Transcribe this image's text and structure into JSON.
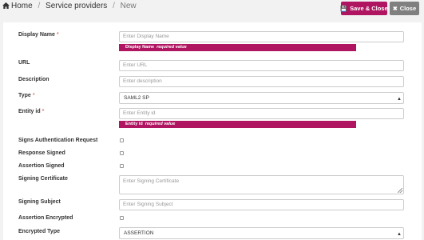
{
  "breadcrumb": {
    "home": "Home",
    "section": "Service providers",
    "current": "New"
  },
  "toolbar": {
    "save_label": "Save & Close",
    "close_label": "Close"
  },
  "form": {
    "display_name": {
      "label": "Display Name",
      "required": "*",
      "placeholder": "Enter Display Name",
      "error_field": "Display Name",
      "error_text": "required value"
    },
    "url": {
      "label": "URL",
      "placeholder": "Enter URL"
    },
    "description": {
      "label": "Description",
      "placeholder": "Enter description"
    },
    "type": {
      "label": "Type",
      "required": "*",
      "value": "SAML2 SP"
    },
    "entity_id": {
      "label": "Entity id",
      "required": "*",
      "placeholder": "Enter Entity id",
      "error_field": "Entity id",
      "error_text": "required value"
    },
    "signs_auth_request": {
      "label": "Signs Authentication Request",
      "checked": false
    },
    "response_signed": {
      "label": "Response Signed",
      "checked": false
    },
    "assertion_signed": {
      "label": "Assertion Signed",
      "checked": false
    },
    "signing_certificate": {
      "label": "Signing Certificate",
      "placeholder": "Enter Signing Certificate"
    },
    "signing_subject": {
      "label": "Signing Subject",
      "placeholder": "Enter Signing Subject"
    },
    "assertion_encrypted": {
      "label": "Assertion Encrypted",
      "checked": false
    },
    "encrypted_type": {
      "label": "Encrypted Type",
      "value": "ASSERTION"
    }
  },
  "colors": {
    "accent": "#b01561",
    "close_button": "#808080",
    "background": "#f2f2f2"
  },
  "icons": {
    "home": "home-icon",
    "save": "save-icon",
    "close": "close-icon",
    "select_caret": "caret-updown-icon"
  }
}
